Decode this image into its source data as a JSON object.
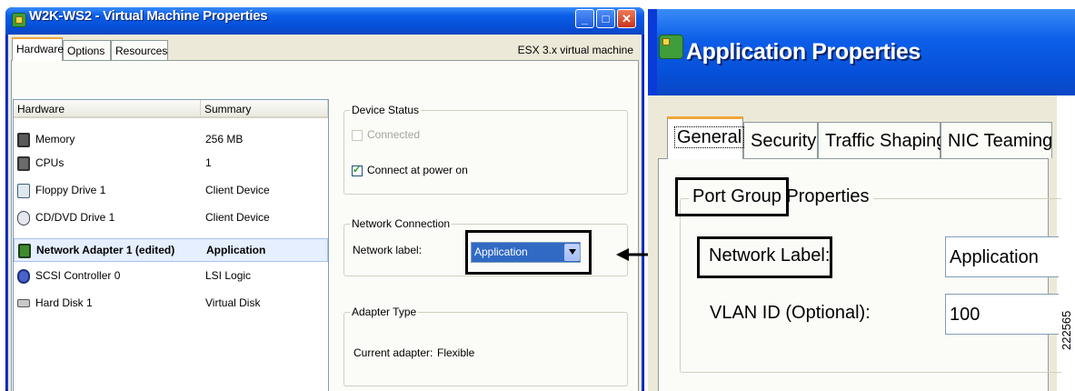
{
  "left_window": {
    "title": "W2K-WS2 - Virtual Machine Properties",
    "controls": {
      "minimize": "_",
      "maximize": "□",
      "close": "✕"
    },
    "tabs": [
      "Hardware",
      "Options",
      "Resources"
    ],
    "subtitle": "ESX 3.x virtual machine",
    "hardware_list": {
      "headers": [
        "Hardware",
        "Summary"
      ],
      "rows": [
        {
          "name": "Memory",
          "summary": "256 MB",
          "icon": "memory-icon"
        },
        {
          "name": "CPUs",
          "summary": "1",
          "icon": "cpu-icon"
        },
        {
          "name": "Floppy Drive 1",
          "summary": "Client Device",
          "icon": "floppy-icon"
        },
        {
          "name": "CD/DVD Drive 1",
          "summary": "Client Device",
          "icon": "cd-dvd-icon"
        },
        {
          "name": "Network Adapter 1 (edited)",
          "summary": "Application",
          "icon": "network-adapter-icon",
          "selected": true
        },
        {
          "name": "SCSI Controller 0",
          "summary": "LSI Logic",
          "icon": "scsi-icon"
        },
        {
          "name": "Hard Disk 1",
          "summary": "Virtual Disk",
          "icon": "hard-disk-icon"
        }
      ]
    },
    "device_status": {
      "legend": "Device Status",
      "connected_label": "Connected",
      "connected_checked": false,
      "connected_enabled": false,
      "power_on_label": "Connect at power on",
      "power_on_checked": true
    },
    "network_connection": {
      "legend": "Network Connection",
      "label": "Network label:",
      "selected_value": "Application"
    },
    "adapter_type": {
      "legend": "Adapter Type",
      "label": "Current adapter:",
      "value": "Flexible"
    }
  },
  "right_window": {
    "title": "Application Properties",
    "tabs": [
      "General",
      "Security",
      "Traffic Shaping",
      "NIC Teaming"
    ],
    "group_legend": "Port Group Properties",
    "network_label_label": "Network Label:",
    "network_label_value": "Application",
    "vlan_label": "VLAN ID (Optional):",
    "vlan_value": "100"
  },
  "figure_number": "222565",
  "colors": {
    "titlebar_blue": "#0a5be0",
    "selection_blue": "#316ac5",
    "window_face": "#ece9d8",
    "active_tab_accent": "#f2a43a"
  }
}
